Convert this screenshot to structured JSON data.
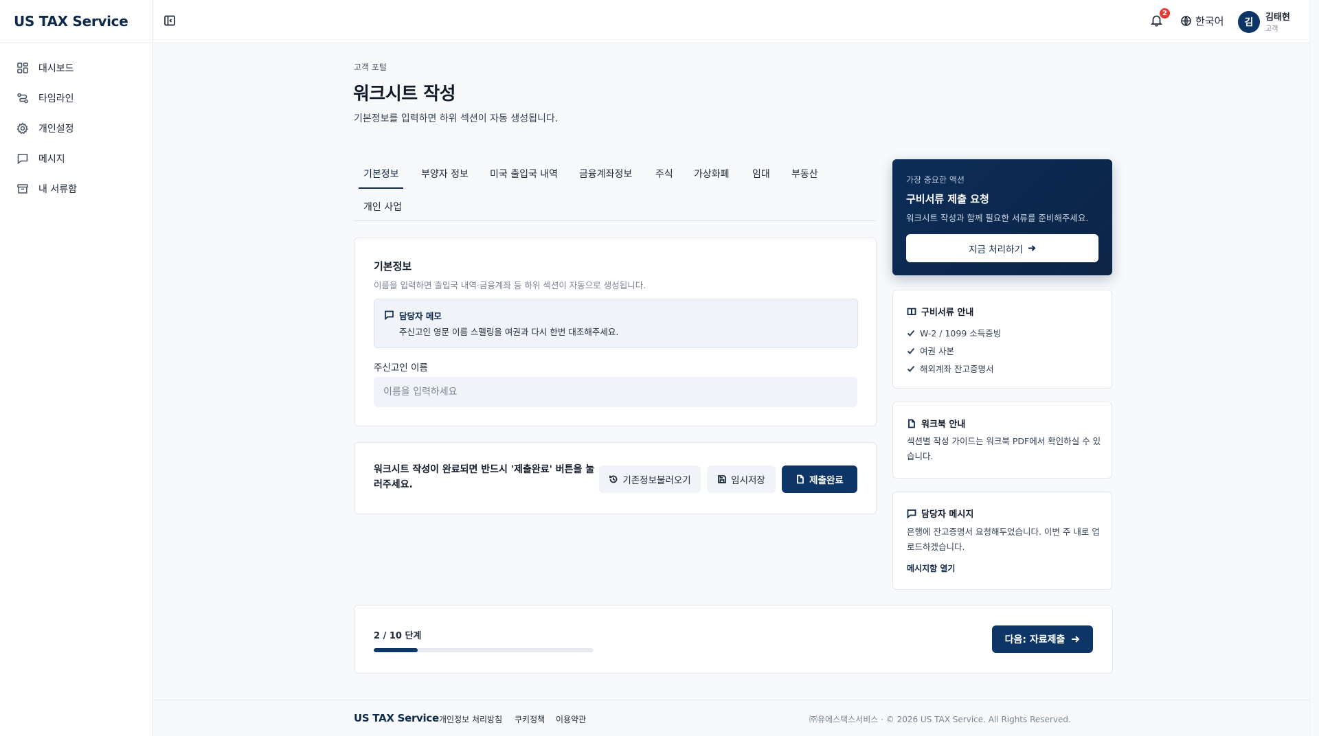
{
  "app": {
    "brand": "US TAX Service"
  },
  "sidebar": {
    "items": [
      {
        "label": "대시보드",
        "icon": "dashboard-icon"
      },
      {
        "label": "타임라인",
        "icon": "timeline-icon"
      },
      {
        "label": "개인설정",
        "icon": "gear-icon"
      },
      {
        "label": "메시지",
        "icon": "message-icon"
      },
      {
        "label": "내 서류함",
        "icon": "archive-icon"
      }
    ]
  },
  "header": {
    "notification_count": "2",
    "language": "한국어",
    "user": {
      "initial": "김",
      "name": "김태현",
      "role": "고객"
    }
  },
  "page": {
    "breadcrumb": "고객 포털",
    "title": "워크시트 작성",
    "subtitle": "기본정보를 입력하면 하위 섹션이 자동 생성됩니다."
  },
  "tabs": [
    {
      "label": "기본정보",
      "active": true
    },
    {
      "label": "부양자 정보",
      "active": false
    },
    {
      "label": "미국 출입국 내역",
      "active": false
    },
    {
      "label": "금융계좌정보",
      "active": false
    },
    {
      "label": "주식",
      "active": false
    },
    {
      "label": "가상화폐",
      "active": false
    },
    {
      "label": "임대",
      "active": false
    },
    {
      "label": "부동산",
      "active": false
    },
    {
      "label": "개인 사업",
      "active": false
    }
  ],
  "form": {
    "title": "기본정보",
    "subtitle": "이름을 입력하면 출입국 내역·금융계좌 등 하위 섹션이 자동으로 생성됩니다.",
    "memo": {
      "title": "담당자 메모",
      "text": "주신고인 영문 이름 스펠링을 여권과 다시 한번 대조해주세요."
    },
    "name_label": "주신고인 이름",
    "name_value": "",
    "name_placeholder": "이름을 입력하세요"
  },
  "actions": {
    "notice": "워크시트 작성이 완료되면 반드시 '제출완료' 버튼을 눌러주세요.",
    "load_label": "기존정보불러오기",
    "save_label": "임시저장",
    "submit_label": "제출완료"
  },
  "priority": {
    "kicker": "가장 중요한 액션",
    "title": "구비서류 제출 요청",
    "subtitle": "워크시트 작성과 함께 필요한 서류를 준비해주세요.",
    "button": "지금 처리하기"
  },
  "docs_guide": {
    "title": "구비서류 안내",
    "items": [
      "W-2 / 1099 소득증빙",
      "여권 사본",
      "해외계좌 잔고증명서"
    ]
  },
  "workbook": {
    "title": "워크북 안내",
    "text": "섹션별 작성 가이드는 워크북 PDF에서 확인하실 수 있습니다."
  },
  "manager_message": {
    "title": "담당자 메시지",
    "text": "은행에 잔고증명서 요청해두었습니다. 이번 주 내로 업로드하겠습니다.",
    "link": "메시지함 열기"
  },
  "progress": {
    "label": "2 / 10 단계",
    "fraction": 0.2,
    "next_label": "다음: 자료제출"
  },
  "footer": {
    "brand": "US TAX Service",
    "links": [
      "개인정보 처리방침",
      "쿠키정책",
      "이용약관"
    ],
    "copyright": "㈜유에스택스서비스 · © 2026 US TAX Service. All Rights Reserved."
  },
  "colors": {
    "primary": "#0d3566",
    "badge": "#e53935",
    "page_bg": "#f7f9fb"
  }
}
